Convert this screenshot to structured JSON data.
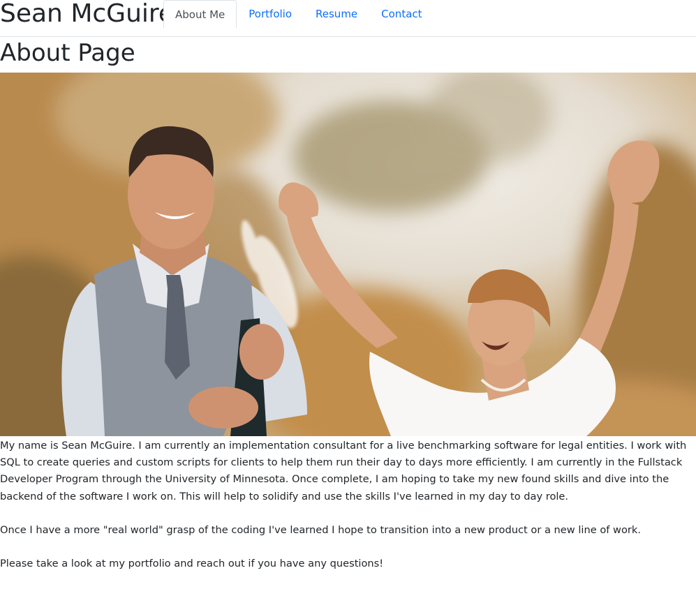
{
  "header": {
    "brand": "Sean McGuire",
    "tabs": [
      {
        "label": "About Me",
        "active": true
      },
      {
        "label": "Portfolio",
        "active": false
      },
      {
        "label": "Resume",
        "active": false
      },
      {
        "label": "Contact",
        "active": false
      }
    ]
  },
  "main": {
    "title": "About Page",
    "paragraphs": [
      "My name is Sean McGuire. I am currently an implementation consultant for a live benchmarking software for legal entities. I work with SQL to create queries and custom scripts for clients to help them run their day to days more efficiently. I am currently in the Fullstack Developer Program through the University of Minnesota. Once complete, I am hoping to take my new found skills and dive into the backend of the software I work on. This will help to solidify and use the skills I've learned in my day to day role.",
      "Once I have a more \"real world\" grasp of the coding I've learned I hope to transition into a new product or a new line of work.",
      "Please take a look at my portfolio and reach out if you have any questions!"
    ]
  },
  "colors": {
    "link": "#0d6efd",
    "active_tab": "#495057",
    "text": "#212529",
    "border": "#dee2e6"
  }
}
